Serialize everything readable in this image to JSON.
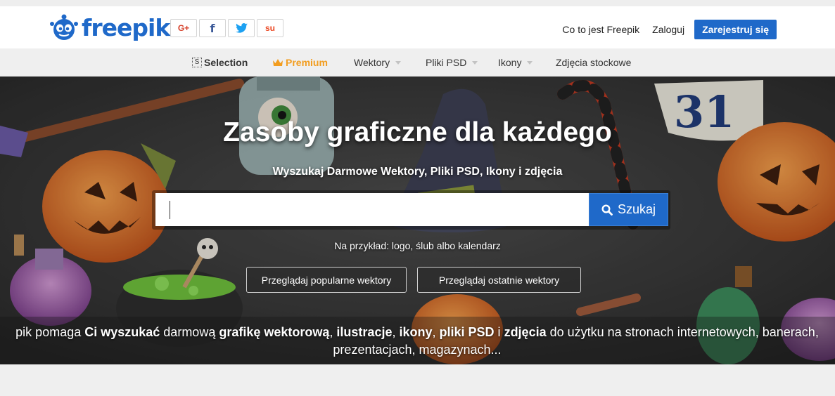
{
  "header": {
    "logo_text": "freepik",
    "share_buttons": [
      {
        "icon": "google-plus-icon",
        "label": "G+",
        "color": "#d6402a"
      },
      {
        "icon": "facebook-icon",
        "label": "f",
        "color": "#3b5998"
      },
      {
        "icon": "twitter-icon",
        "label": "",
        "color": "#1da1f2"
      },
      {
        "icon": "stumbleupon-icon",
        "label": "su",
        "color": "#eb4924"
      }
    ],
    "about_link": "Co to jest Freepik",
    "login_link": "Zaloguj",
    "register_button": "Zarejestruj się",
    "accent_color": "#1f69c9"
  },
  "nav": {
    "selection": "Selection",
    "selection_icon": "S",
    "premium": "Premium",
    "premium_color": "#f29d1f",
    "items": [
      "Wektory",
      "Pliki PSD",
      "Ikony",
      "Zdjęcia stockowe"
    ]
  },
  "hero": {
    "title": "Zasoby graficzne dla każdego",
    "subtitle": "Wyszukaj Darmowe Wektory, Pliki PSD, Ikony i zdjęcia",
    "search_placeholder": "",
    "search_button": "Szukaj",
    "example_text": "Na przykład: logo, ślub albo kalendarz",
    "browse_popular": "Przeglądaj popularne wektory",
    "browse_recent": "Przeglądaj ostatnie wektory",
    "calendar_number": "31"
  },
  "tagline": {
    "p1": "pik pomaga ",
    "b1": "Ci wyszukać",
    "p2": " darmową ",
    "b2": "grafikę wektorową",
    "p3": ", ",
    "b3": "ilustracje",
    "p4": ", ",
    "b4": "ikony",
    "p5": ", ",
    "b5": "pliki PSD",
    "p6": " i ",
    "b6": "zdjęcia",
    "p7": " do użytku na stronach internetowych, banerach,",
    "line2": "prezentacjach, magazynach..."
  }
}
